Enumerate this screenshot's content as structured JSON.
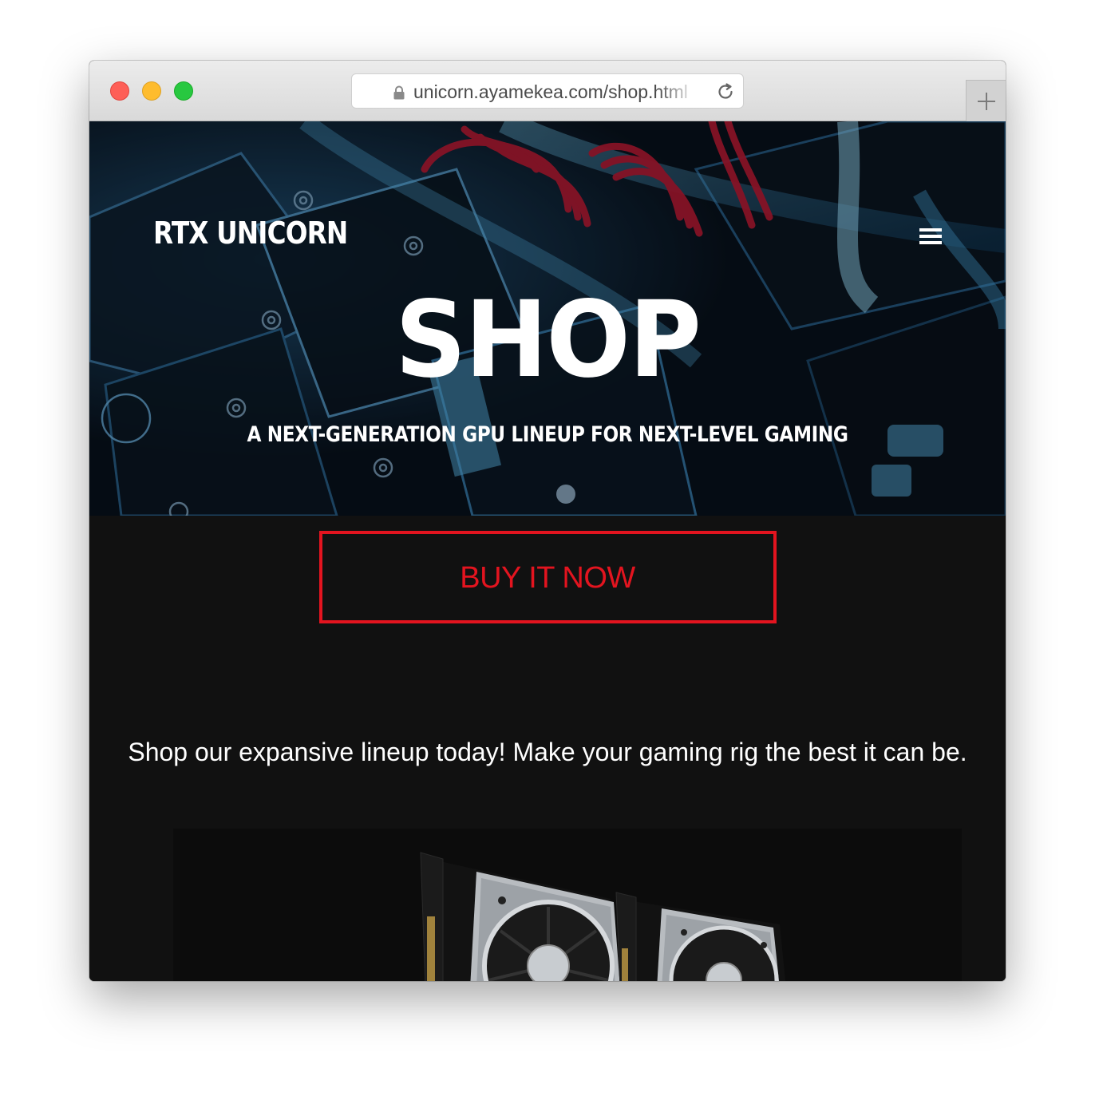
{
  "browser": {
    "url": "unicorn.ayamekea.com/shop.html"
  },
  "site": {
    "brand": "RTX UNICORN"
  },
  "hero": {
    "title": "SHOP",
    "subtitle": "A NEXT-GENERATION GPU LINEUP FOR NEXT-LEVEL GAMING",
    "cta_label": "BUY IT NOW"
  },
  "main": {
    "intro": "Shop our expansive lineup today! Make your gaming rig the best it can be."
  },
  "colors": {
    "accent": "#e3141f",
    "page_background": "#111111",
    "text": "#ffffff"
  },
  "icons": {
    "lock": "lock-icon",
    "reload": "reload-icon",
    "new_tab": "plus-icon",
    "menu": "hamburger-menu-icon"
  }
}
